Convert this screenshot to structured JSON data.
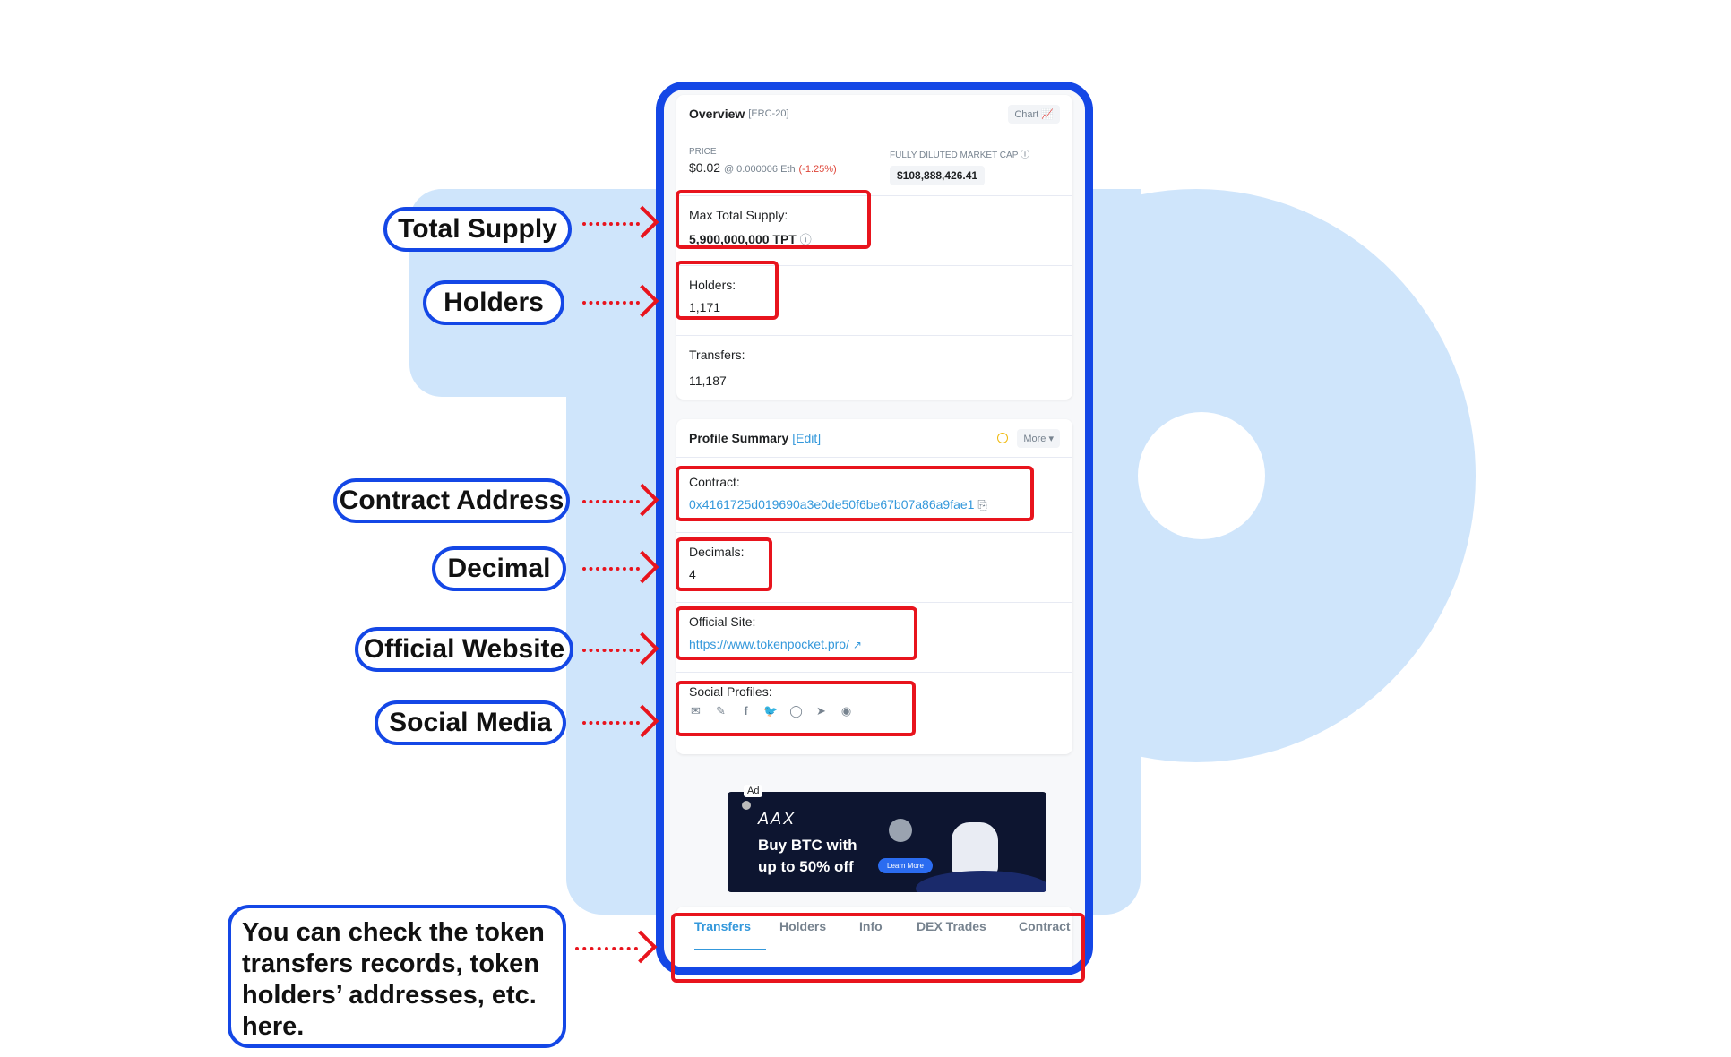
{
  "overview": {
    "title": "Overview",
    "token_type": "[ERC-20]",
    "chart_label": "Chart",
    "price_label": "PRICE",
    "price_value": "$0.02",
    "price_eth": "@ 0.000006 Eth",
    "price_change": "(-1.25%)",
    "mcap_label": "FULLY DILUTED MARKET CAP",
    "mcap_value": "$108,888,426.41",
    "supply_label": "Max Total Supply:",
    "supply_value": "5,900,000,000 TPT",
    "holders_label": "Holders:",
    "holders_value": "1,171",
    "transfers_label": "Transfers:",
    "transfers_value": "11,187"
  },
  "profile": {
    "title": "Profile Summary",
    "edit_label": "[Edit]",
    "more_label": "More",
    "contract_label": "Contract:",
    "contract_value": "0x4161725d019690a3e0de50f6be67b07a86a9fae1",
    "decimals_label": "Decimals:",
    "decimals_value": "4",
    "site_label": "Official Site:",
    "site_value": "https://www.tokenpocket.pro/",
    "social_label": "Social Profiles:",
    "social_icons": [
      "email-icon",
      "pencil-icon",
      "facebook-icon",
      "twitter-icon",
      "github-icon",
      "telegram-icon",
      "reddit-icon"
    ]
  },
  "ad": {
    "label": "Ad",
    "brand": "AAX",
    "line1": "Buy BTC with",
    "line2": "up to 50% off",
    "cta": "Learn More"
  },
  "tabs": [
    "Transfers",
    "Holders",
    "Info",
    "DEX Trades",
    "Contract",
    "Analytics",
    "Comments"
  ],
  "callouts": {
    "total_supply": "Total Supply",
    "holders": "Holders",
    "contract_address": "Contract Address",
    "decimal": "Decimal",
    "official_website": "Official Website",
    "social_media": "Social Media",
    "note": "You can check the token transfers records, token holders’ addresses, etc. here."
  },
  "colors": {
    "frame_blue": "#1447e6",
    "highlight_red": "#e8141d",
    "link_blue": "#3498db",
    "background_logo": "#cfe5fb"
  }
}
